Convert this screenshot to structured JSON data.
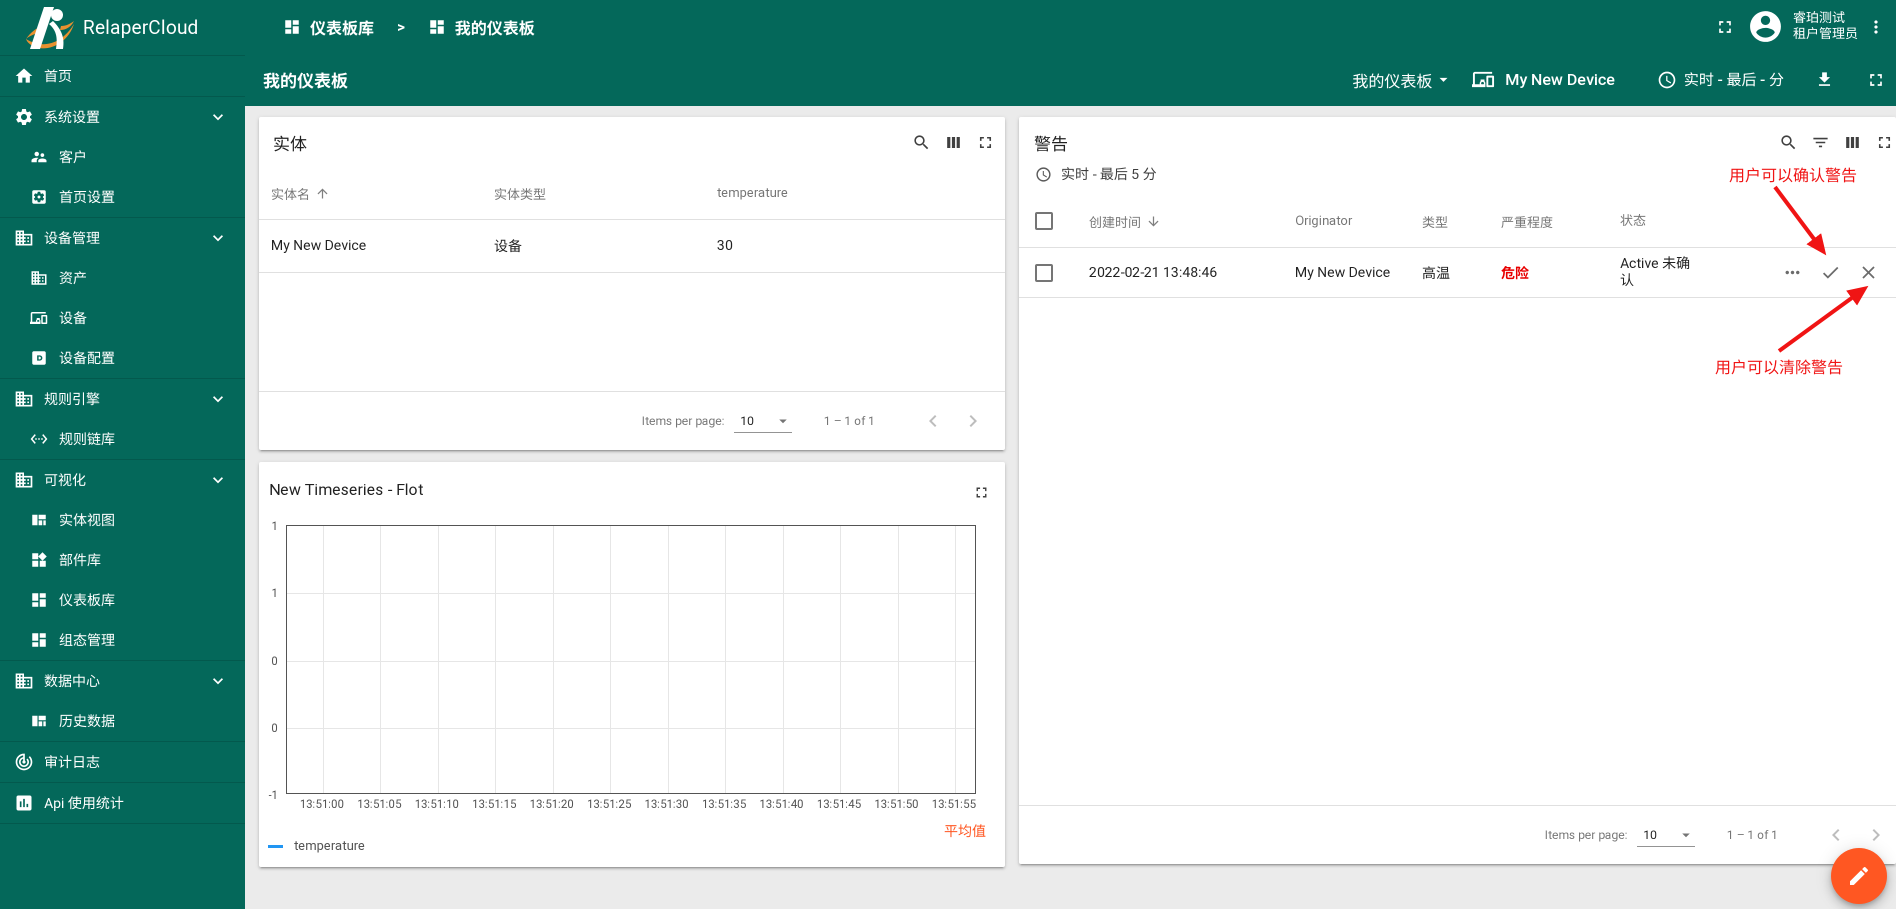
{
  "app": {
    "name": "RelaperCloud"
  },
  "colors": {
    "primary_teal": "#04685A",
    "fab_orange": "#FF5722",
    "annotation_red": "#F01414",
    "severity_critical_red": "#E80000",
    "series_blue": "#2196F3",
    "average_orange": "#FF5722"
  },
  "sidebar": {
    "items": [
      {
        "label": "首页",
        "icon": "home-icon"
      },
      {
        "label": "系统设置",
        "icon": "gear-icon",
        "expanded": true
      },
      {
        "label": "客户",
        "icon": "customers-icon",
        "sub": true
      },
      {
        "label": "首页设置",
        "icon": "home-settings-icon",
        "sub": true
      },
      {
        "label": "设备管理",
        "icon": "building-icon",
        "expanded": true
      },
      {
        "label": "资产",
        "icon": "building-icon",
        "sub": true
      },
      {
        "label": "设备",
        "icon": "devices-icon",
        "sub": true
      },
      {
        "label": "设备配置",
        "icon": "device-profile-icon",
        "sub": true
      },
      {
        "label": "规则引擎",
        "icon": "building-icon",
        "expanded": true
      },
      {
        "label": "规则链库",
        "icon": "rule-chain-icon",
        "sub": true
      },
      {
        "label": "可视化",
        "icon": "building-icon",
        "expanded": true
      },
      {
        "label": "实体视图",
        "icon": "entity-view-icon",
        "sub": true
      },
      {
        "label": "部件库",
        "icon": "widgets-icon",
        "sub": true
      },
      {
        "label": "仪表板库",
        "icon": "dashboard-icon",
        "sub": true
      },
      {
        "label": "组态管理",
        "icon": "dashboard-icon",
        "sub": true
      },
      {
        "label": "数据中心",
        "icon": "building-icon",
        "expanded": true
      },
      {
        "label": "历史数据",
        "icon": "entity-view-icon",
        "sub": true
      },
      {
        "label": "审计日志",
        "icon": "audit-log-icon"
      },
      {
        "label": "Api 使用统计",
        "icon": "api-usage-icon"
      }
    ]
  },
  "topbar": {
    "breadcrumb": [
      {
        "label": "仪表板库"
      },
      {
        "label": "我的仪表板"
      }
    ],
    "breadcrumb_separator": ">",
    "user": {
      "name": "睿珀测试",
      "role": "租户管理员"
    }
  },
  "toolbar": {
    "title": "我的仪表板",
    "states_select": "我的仪表板",
    "entity_label": "My New Device",
    "timewindow": "实时 - 最后 - 分"
  },
  "entities_widget": {
    "title": "实体",
    "columns": [
      "实体名",
      "实体类型",
      "temperature"
    ],
    "rows": [
      {
        "name": "My New Device",
        "type": "设备",
        "temperature": "30"
      }
    ],
    "paginator": {
      "items_per_page_label": "Items per page:",
      "page_size": "10",
      "range": "1 – 1 of 1"
    }
  },
  "alarms_widget": {
    "title": "警告",
    "subtitle": "实时 - 最后 5 分",
    "columns": [
      "创建时间",
      "Originator",
      "类型",
      "严重程度",
      "状态"
    ],
    "rows": [
      {
        "created_time": "2022-02-21 13:48:46",
        "originator": "My New Device",
        "type": "高温",
        "severity": "危险",
        "status": "Active 未确认"
      }
    ],
    "paginator": {
      "items_per_page_label": "Items per page:",
      "page_size": "10",
      "range": "1 – 1 of 1"
    }
  },
  "annotations": {
    "ack_note": "用户可以确认警告",
    "clear_note": "用户可以清除警告"
  },
  "chart_widget": {
    "title": "New Timeseries - Flot",
    "legend_average_label": "平均值"
  },
  "chart_data": {
    "type": "line",
    "title": "New Timeseries - Flot",
    "x_ticks": [
      "13:51:00",
      "13:51:05",
      "13:51:10",
      "13:51:15",
      "13:51:20",
      "13:51:25",
      "13:51:30",
      "13:51:35",
      "13:51:40",
      "13:51:45",
      "13:51:50",
      "13:51:55"
    ],
    "y_ticks": [
      "1",
      "1",
      "0",
      "0",
      "-1"
    ],
    "ylim": [
      -1,
      1
    ],
    "grid": true,
    "legend_position": "bottom-left",
    "series": [
      {
        "name": "temperature",
        "color": "#2196F3",
        "values": []
      }
    ]
  }
}
